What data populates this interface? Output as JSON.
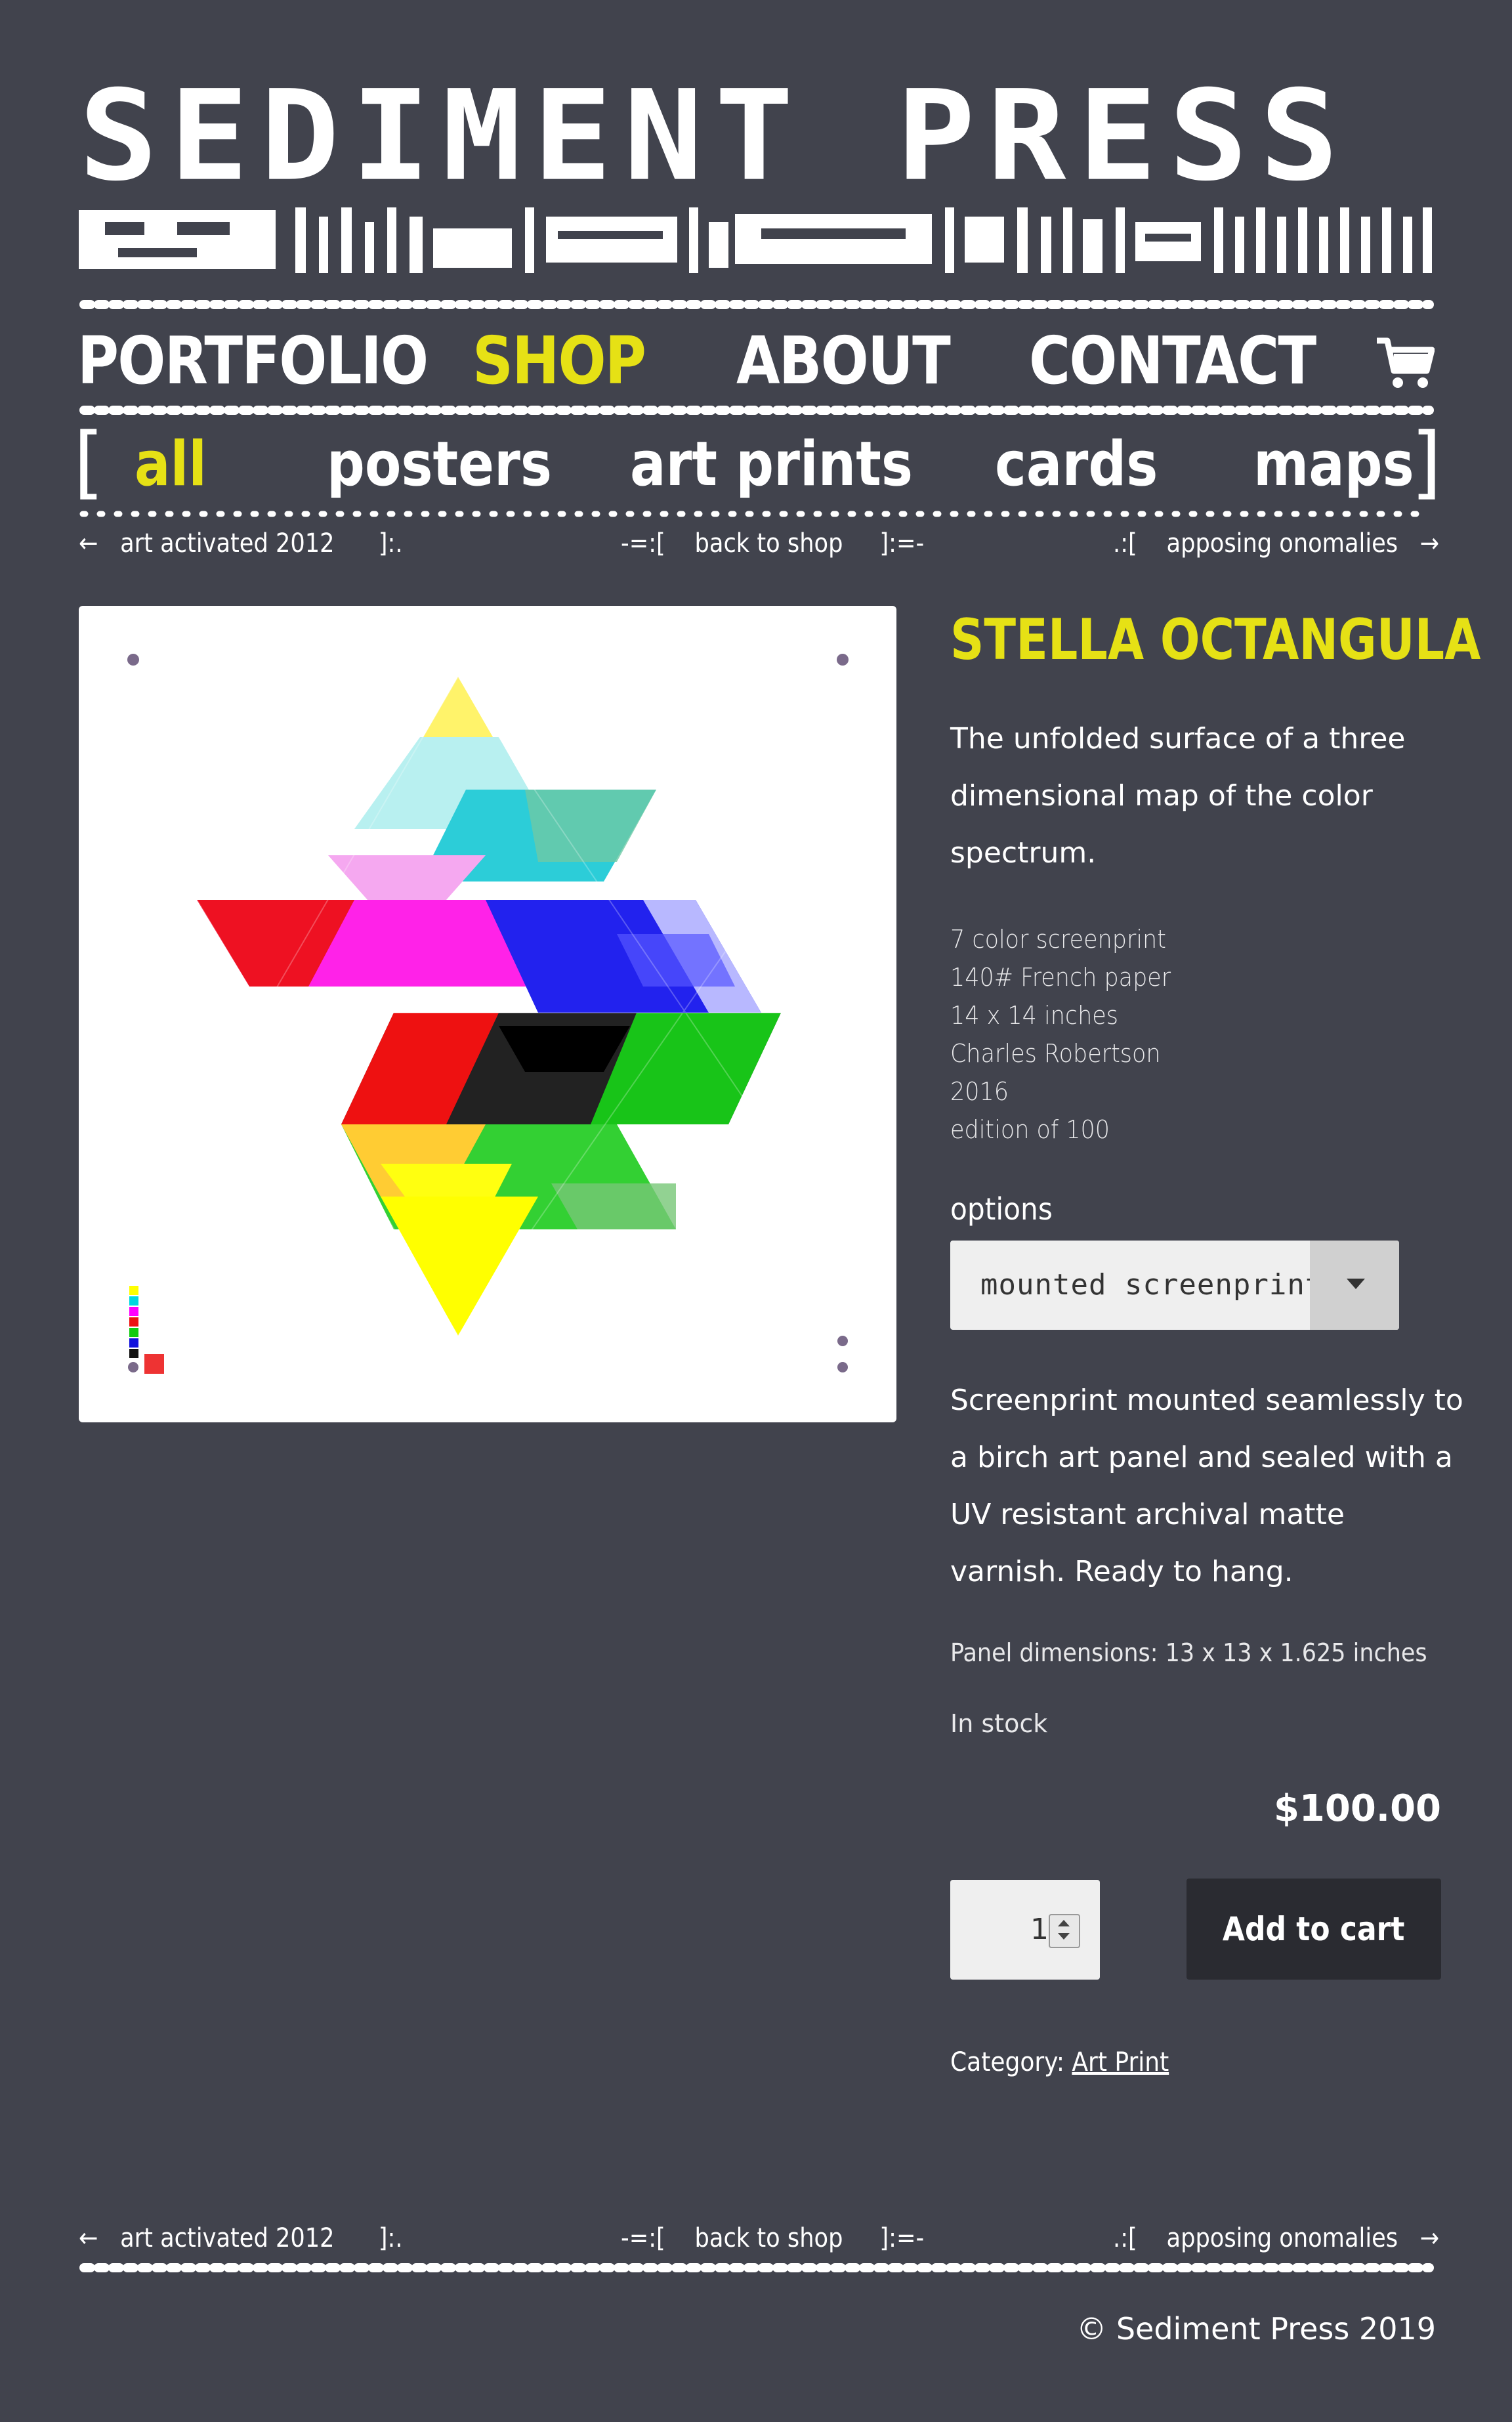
{
  "site": {
    "logo_text": "SEDIMENT PRESS"
  },
  "nav": {
    "items": [
      {
        "label": "PORTFOLIO",
        "active": false
      },
      {
        "label": "SHOP",
        "active": true
      },
      {
        "label": "ABOUT",
        "active": false
      },
      {
        "label": "CONTACT",
        "active": false
      }
    ],
    "cart_icon": "shopping-cart-icon"
  },
  "subnav": {
    "open_bracket": "[",
    "close_bracket": "]",
    "items": [
      {
        "label": "all",
        "active": true
      },
      {
        "label": "posters",
        "active": false
      },
      {
        "label": "art prints",
        "active": false
      },
      {
        "label": "cards",
        "active": false
      },
      {
        "label": "maps",
        "active": false
      }
    ]
  },
  "post_nav": {
    "prev_arrow": "←",
    "prev_label": "art activated 2012",
    "prev_suffix": "]:.",
    "back_prefix": "-=:[",
    "back_label": "back to shop",
    "back_suffix": "]:=-",
    "next_prefix": ".:[",
    "next_label": "apposing onomalies",
    "next_arrow": "→"
  },
  "product": {
    "title": "STELLA OCTANGULA",
    "description": "The unfolded surface of a three dimensional map of the color spectrum.",
    "specs": [
      "7 color screenprint",
      "140# French paper",
      "14 x 14 inches",
      "Charles Robertson",
      "2016",
      "edition of 100"
    ],
    "options_label": "options",
    "selected_option": "mounted screenprint",
    "variation_description": "Screenprint mounted seamlessly to a birch art panel and sealed with a UV resistant archival matte varnish. Ready to hang.",
    "panel_dimensions": "Panel dimensions: 13 x 13 x 1.625 inches",
    "stock": "In stock",
    "price": "$100.00",
    "quantity": "1",
    "add_to_cart": "Add to cart",
    "category_label": "Category:",
    "category_value": "Art Print"
  },
  "footer": {
    "copyright": "© Sediment Press 2019"
  },
  "colors": {
    "background": "#41434d",
    "accent": "#e6e115",
    "button": "#2a2b31"
  }
}
